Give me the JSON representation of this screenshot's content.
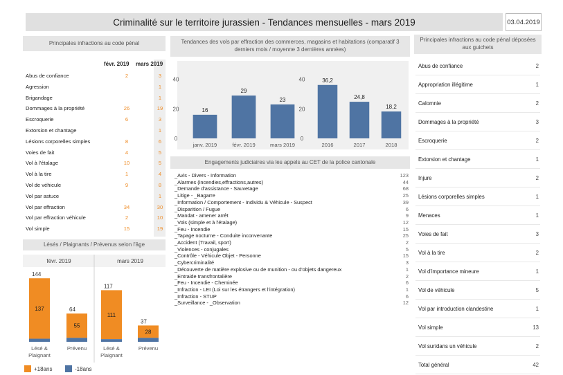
{
  "header": {
    "title": "Criminalité sur le territoire jurassien - Tendances mensuelles - mars 2019",
    "date": "03.04.2019"
  },
  "colors": {
    "orange": "#f08c23",
    "blue": "#4f74a3",
    "panel": "#e6e6e6"
  },
  "table_penal": {
    "title": "Principales infractions au code pénal",
    "col1": "févr. 2019",
    "col2": "mars 2019",
    "rows": [
      {
        "label": "Abus de confiance",
        "v1": "2",
        "v2": "3"
      },
      {
        "label": "Agression",
        "v1": "",
        "v2": "1"
      },
      {
        "label": "Brigandage",
        "v1": "",
        "v2": "1"
      },
      {
        "label": "Dommages à la propriété",
        "v1": "26",
        "v2": "19"
      },
      {
        "label": "Escroquerie",
        "v1": "6",
        "v2": "3"
      },
      {
        "label": "Extorsion et chantage",
        "v1": "",
        "v2": "1"
      },
      {
        "label": "Lésions corporelles simples",
        "v1": "8",
        "v2": "6"
      },
      {
        "label": "Voies de fait",
        "v1": "4",
        "v2": "5"
      },
      {
        "label": "Vol à l'étalage",
        "v1": "10",
        "v2": "5"
      },
      {
        "label": "Vol à la tire",
        "v1": "1",
        "v2": "4"
      },
      {
        "label": "Vol de véhicule",
        "v1": "9",
        "v2": "8"
      },
      {
        "label": "Vol par astuce",
        "v1": "",
        "v2": "1"
      },
      {
        "label": "Vol par effraction",
        "v1": "34",
        "v2": "30"
      },
      {
        "label": "Vol par effraction véhicule",
        "v1": "2",
        "v2": "10"
      },
      {
        "label": "Vol simple",
        "v1": "15",
        "v2": "19"
      }
    ]
  },
  "engagements": {
    "title": "Engagements judiciaires via les appels au CET de la police cantonale",
    "rows": [
      {
        "label": "_Avis - Divers - Information",
        "value": "123"
      },
      {
        "label": "_Alarmes (incendies,effractions,autres)",
        "value": "44"
      },
      {
        "label": "_Demande d'assistance - Sauvetage",
        "value": "68"
      },
      {
        "label": "_Litige - _Bagarre",
        "value": "25"
      },
      {
        "label": "_Information / Comportement - Individu & Véhicule - Suspect",
        "value": "39"
      },
      {
        "label": "_Disparition / Fugue",
        "value": "6"
      },
      {
        "label": "_Mandat - amener arrêt",
        "value": "9"
      },
      {
        "label": "_Vols (simple et à l'étalage)",
        "value": "12"
      },
      {
        "label": "_Feu - Incendie",
        "value": "15"
      },
      {
        "label": "_Tapage nocturne - Conduite inconvenante",
        "value": "25"
      },
      {
        "label": "_Accident (Travail, sport)",
        "value": "2"
      },
      {
        "label": "_Violences - conjugales",
        "value": "5"
      },
      {
        "label": "_Contrôle - Véhicule Objet - Personne",
        "value": "15"
      },
      {
        "label": "_Cybercriminalité",
        "value": "3"
      },
      {
        "label": "_Découverte de matière explosive ou de munition - ou d'objets dangereux",
        "value": "1"
      },
      {
        "label": "_Entraide transfrontalière",
        "value": "2"
      },
      {
        "label": "_Feu - Incendie - Cheminée",
        "value": "6"
      },
      {
        "label": "_Infraction - LEI (Loi sur les étrangers et l'intégration)",
        "value": "1"
      },
      {
        "label": "_Infraction - STUP",
        "value": "6"
      },
      {
        "label": "_Surveillance - _Observation",
        "value": "12"
      }
    ]
  },
  "table_guichets": {
    "title": "Principales infractions au code pénal déposées aux guichets",
    "rows": [
      {
        "label": "Abus de confiance",
        "value": "2"
      },
      {
        "label": "Appropriation illégitime",
        "value": "1"
      },
      {
        "label": "Calomnie",
        "value": "2"
      },
      {
        "label": "Dommages à la propriété",
        "value": "3"
      },
      {
        "label": "Escroquerie",
        "value": "2"
      },
      {
        "label": "Extorsion et chantage",
        "value": "1"
      },
      {
        "label": "Injure",
        "value": "2"
      },
      {
        "label": "Lésions corporelles simples",
        "value": "1"
      },
      {
        "label": "Menaces",
        "value": "1"
      },
      {
        "label": "Voies de fait",
        "value": "3"
      },
      {
        "label": "Vol à la tire",
        "value": "2"
      },
      {
        "label": "Vol d'importance mineure",
        "value": "1"
      },
      {
        "label": "Vol de véhicule",
        "value": "5"
      },
      {
        "label": "Vol par introduction clandestine",
        "value": "1"
      },
      {
        "label": "Vol simple",
        "value": "13"
      },
      {
        "label": "Vol sur/dans un véhicule",
        "value": "2"
      },
      {
        "label": "Total général",
        "value": "42"
      }
    ]
  },
  "chart_data": [
    {
      "type": "bar",
      "title": "Tendances des vols par effraction des commerces, magasins et habitations (comparatif 3 derniers mois / moyenne 3 dernières années)",
      "panel": "months",
      "categories": [
        "janv. 2019",
        "févr. 2019",
        "mars 2019"
      ],
      "values": [
        16,
        29,
        23
      ],
      "labels": [
        "16",
        "29",
        "23"
      ],
      "ylim": [
        0,
        45
      ],
      "yticks": [
        0,
        20,
        40
      ],
      "color": "#4f74a3"
    },
    {
      "type": "bar",
      "panel": "years",
      "categories": [
        "2016",
        "2017",
        "2018"
      ],
      "values": [
        36.2,
        24.8,
        18.2
      ],
      "labels": [
        "36,2",
        "24,8",
        "18,2"
      ],
      "ylim": [
        0,
        45
      ],
      "yticks": [
        0,
        20,
        40
      ],
      "color": "#4f74a3"
    },
    {
      "type": "bar",
      "title": "Lésés / Plaignants / Prévenus selon l'âge",
      "stacked": true,
      "groups": [
        "févr. 2019",
        "mars 2019"
      ],
      "categories": [
        "Lésé & Plaignant",
        "Prévenu"
      ],
      "bars": [
        {
          "group": "févr. 2019",
          "category": "Lésé & Plaignant",
          "total": 144,
          "adult": 137
        },
        {
          "group": "févr. 2019",
          "category": "Prévenu",
          "total": 64,
          "adult": 55
        },
        {
          "group": "mars 2019",
          "category": "Lésé & Plaignant",
          "total": 117,
          "adult": 111
        },
        {
          "group": "mars 2019",
          "category": "Prévenu",
          "total": 37,
          "adult": 28
        }
      ],
      "series": [
        {
          "name": "+18ans",
          "color": "#f08c23"
        },
        {
          "name": "-18ans",
          "color": "#4f74a3"
        }
      ],
      "ylim": [
        0,
        160
      ]
    }
  ]
}
